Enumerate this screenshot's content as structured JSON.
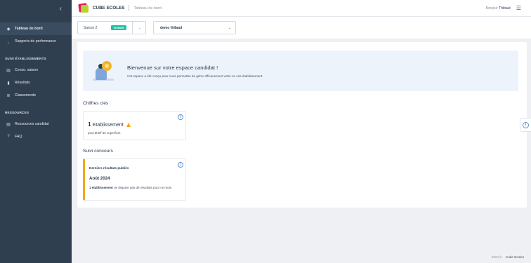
{
  "sidebar": {
    "collapse_icon": "chevron-left-icon",
    "items_top": [
      {
        "label": "Tableau de bord",
        "icon": "diamond-icon",
        "active": true
      },
      {
        "label": "Rapports de performance",
        "icon": "chart-line-icon"
      }
    ],
    "section_suivi": "SUIVI ÉTABLISSEMENTS",
    "items_suivi": [
      {
        "label": "Conso. saison",
        "icon": "building-icon"
      },
      {
        "label": "Résultats",
        "icon": "bar-chart-icon"
      },
      {
        "label": "Classements",
        "icon": "list-icon"
      }
    ],
    "section_ressources": "RESSOURCES",
    "items_ressources": [
      {
        "label": "Ressources candidat",
        "icon": "document-icon"
      },
      {
        "label": "FAQ",
        "icon": "question-icon"
      }
    ]
  },
  "header": {
    "brand": "CUBE ECOLES",
    "breadcrumb": "Tableau de bord",
    "greeting": "Bonjour",
    "user": "Thibaut"
  },
  "filters": {
    "season": "Saison 2",
    "season_badge": "Terminée",
    "account": "demo thibaut"
  },
  "welcome": {
    "title": "Bienvenue sur votre espace candidat !",
    "subtitle": "Cet espace a été conçu pour vous permettre de gérer efficacement votre ou vos établissement."
  },
  "chiffres": {
    "section_title": "Chiffres clés",
    "count": "1",
    "label": "Etablissement",
    "sub_prefix": "pour",
    "sub_value": "0 m²",
    "sub_suffix": "de superficie."
  },
  "suivi": {
    "section_title": "Suivi concours",
    "card_title": "Derniers résultats publiés",
    "month": "Août 2024",
    "text_bold": "1 établissement",
    "text_rest": "ne dispose pas de résultats pour ce mois."
  },
  "footer": {
    "year": "2024 ©",
    "brand": "Cube Ecoles"
  },
  "colors": {
    "sidebar": "#2f3f50",
    "accent_badge": "#1fc0a8",
    "warning": "#f2a81c",
    "info": "#5a8ed6"
  }
}
